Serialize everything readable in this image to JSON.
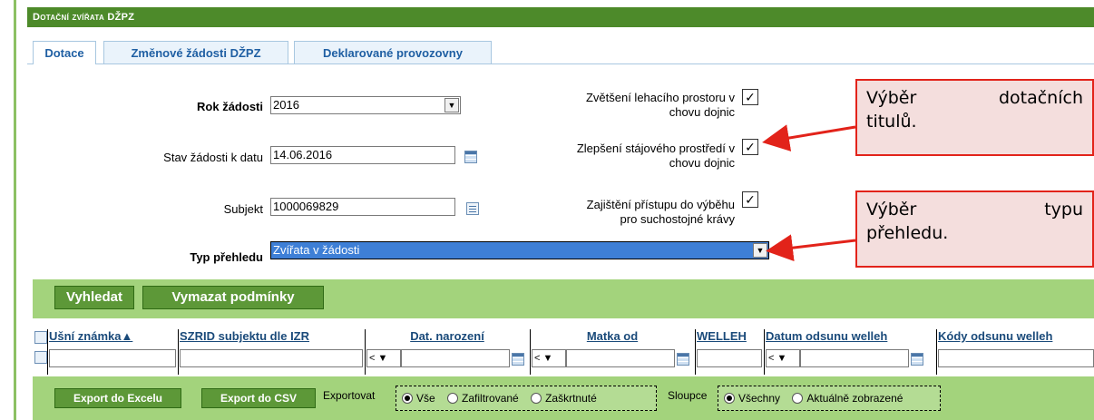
{
  "header": {
    "title": "Dotační zvířata DŽPZ"
  },
  "tabs": [
    {
      "label": "Dotace",
      "active": true
    },
    {
      "label": "Změnové žádosti DŽPZ",
      "active": false
    },
    {
      "label": "Deklarované provozovny",
      "active": false
    }
  ],
  "form": {
    "rok_label": "Rok žádosti",
    "rok_value": "2016",
    "stav_label": "Stav žádosti k datu",
    "stav_value": "14.06.2016",
    "subjekt_label": "Subjekt",
    "subjekt_value": "1000069829",
    "typ_label": "Typ přehledu",
    "typ_value": "Zvířata v žádosti"
  },
  "checkboxes": [
    {
      "line1": "Zvětšení lehacího prostoru v",
      "line2": "chovu dojnic",
      "checked": true
    },
    {
      "line1": "Zlepšení stájového prostředí v",
      "line2": "chovu dojnic",
      "checked": true
    },
    {
      "line1": "Zajištění přístupu do výběhu",
      "line2": "pro suchostojné krávy",
      "checked": true
    }
  ],
  "callouts": {
    "c1_w1": "Výběr",
    "c1_w2": "dotačních",
    "c1_l2": "titulů.",
    "c2_w1": "Výběr",
    "c2_w2": "typu",
    "c2_l2": "přehledu."
  },
  "buttons": {
    "search": "Vyhledat",
    "clear": "Vymazat podmínky"
  },
  "grid": {
    "columns": [
      "Ušní známka▲",
      "SZRID subjektu dle IZR",
      "Dat. narození",
      "Matka od",
      "WELLEH",
      "Datum odsunu welleh",
      "Kódy odsunu welleh"
    ],
    "operator": "<"
  },
  "export": {
    "excel": "Export do Excelu",
    "csv": "Export do CSV",
    "exportovat_label": "Exportovat",
    "exp_opts": [
      "Vše",
      "Zafiltrované",
      "Zaškrtnuté"
    ],
    "sloupce_label": "Sloupce",
    "sl_opts": [
      "Všechny",
      "Aktuálně zobrazené"
    ]
  },
  "colors": {
    "header_bg": "#4d8a2a",
    "green_bar": "#a3d37c",
    "callout_border": "#e2231a",
    "selected_bg": "#3e7fd6"
  }
}
